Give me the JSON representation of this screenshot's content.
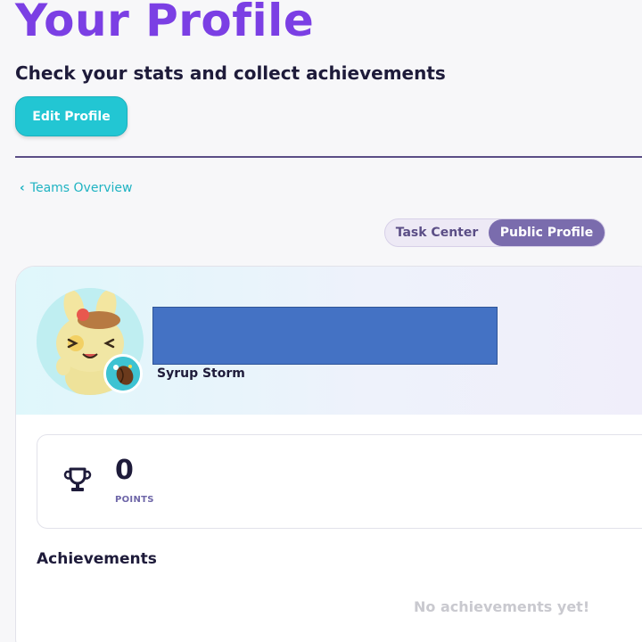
{
  "header": {
    "title": "Your Profile",
    "subtitle": "Check your stats and collect achievements",
    "edit_button": "Edit Profile"
  },
  "nav": {
    "back_link": "Teams Overview"
  },
  "view_toggle": {
    "options": [
      "Task Center",
      "Public Profile"
    ],
    "selected": "Public Profile"
  },
  "profile": {
    "username": "Syrup Storm"
  },
  "stats": {
    "points_value": "0",
    "points_label": "POINTS"
  },
  "achievements": {
    "title": "Achievements",
    "empty_text": "No achievements yet!"
  },
  "colors": {
    "title_purple": "#7b3fe4",
    "accent_teal": "#22c6d3",
    "toggle_active": "#7a6cad",
    "dark_text": "#1e1b3a"
  }
}
